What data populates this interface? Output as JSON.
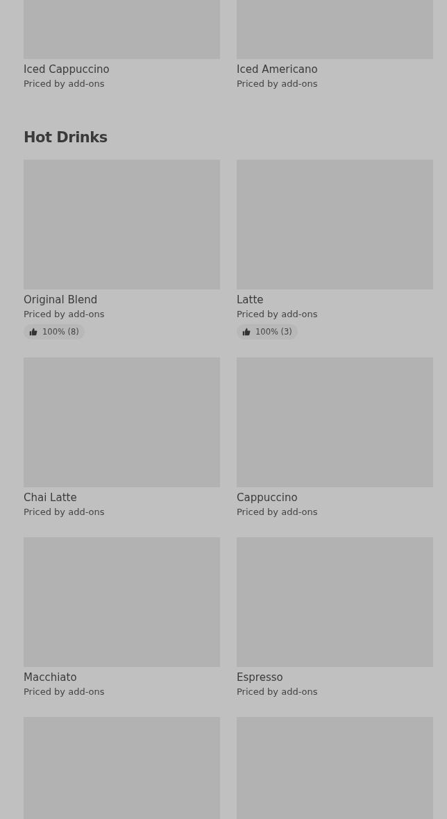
{
  "sections": [
    {
      "items": [
        {
          "kind": "product",
          "name": "Iced Cappuccino",
          "subtitle": "Priced by add-ons"
        },
        {
          "kind": "product",
          "name": "Iced Americano",
          "subtitle": "Priced by add-ons"
        }
      ]
    },
    {
      "title": "Hot Drinks",
      "items": [
        {
          "kind": "product",
          "name": "Original Blend",
          "subtitle": "Priced by add-ons",
          "rating": "100% (8)"
        },
        {
          "kind": "product",
          "name": "Latte",
          "subtitle": "Priced by add-ons",
          "rating": "100% (3)"
        },
        {
          "kind": "product",
          "name": "Chai Latte",
          "subtitle": "Priced by add-ons"
        },
        {
          "kind": "product",
          "name": "Cappuccino",
          "subtitle": "Priced by add-ons"
        },
        {
          "kind": "product",
          "name": "Macchiato",
          "subtitle": "Priced by add-ons"
        },
        {
          "kind": "product",
          "name": "Espresso",
          "subtitle": "Priced by add-ons"
        },
        {
          "kind": "image-only"
        },
        {
          "kind": "image-only"
        }
      ]
    }
  ]
}
